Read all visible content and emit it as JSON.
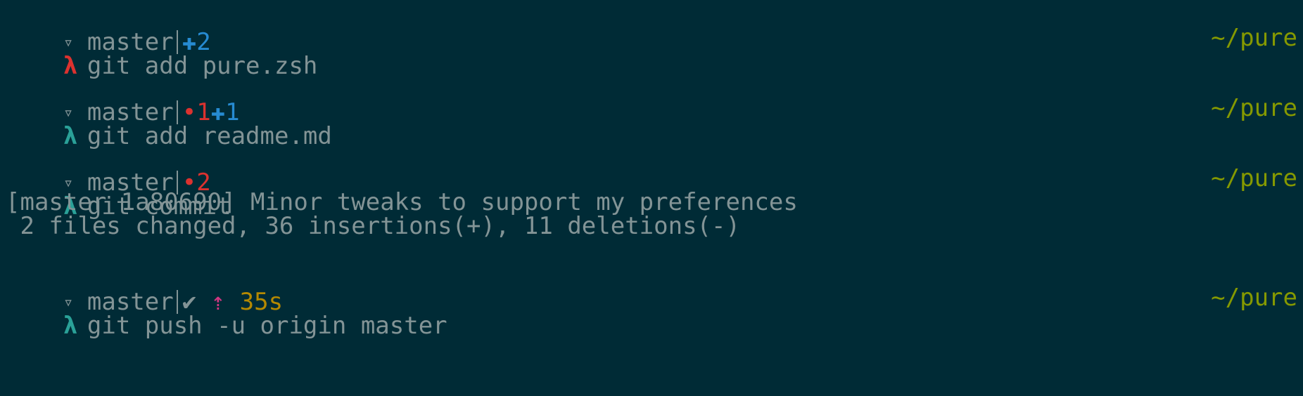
{
  "colors": {
    "background": "#002b36",
    "text": "#839496",
    "prompt_error": "#dc322f",
    "prompt_ok": "#2aa198",
    "staged": "#268bd2",
    "unstaged": "#dc322f",
    "clean": "#839496",
    "ahead": "#d33682",
    "exec_time": "#b58900",
    "path": "#859900"
  },
  "icons": {
    "branch": "▿",
    "prompt": "λ",
    "staged": "✚",
    "unstaged": "•",
    "clean": "✔",
    "ahead": "⇡"
  },
  "blocks": [
    {
      "status": {
        "branch": "master",
        "indicators": [
          {
            "kind": "staged",
            "text": "✚2",
            "color": "#268bd2"
          }
        ]
      },
      "prompt": {
        "symbol": "λ",
        "state": "error",
        "color": "#dc322f",
        "command": "git add pure.zsh",
        "path": "~/pure"
      },
      "output": []
    },
    {
      "status": {
        "branch": "master",
        "indicators": [
          {
            "kind": "unstaged",
            "text": "•1",
            "color": "#dc322f"
          },
          {
            "kind": "staged",
            "text": "✚1",
            "color": "#268bd2"
          }
        ]
      },
      "prompt": {
        "symbol": "λ",
        "state": "ok",
        "color": "#2aa198",
        "command": "git add readme.md",
        "path": "~/pure"
      },
      "output": []
    },
    {
      "status": {
        "branch": "master",
        "indicators": [
          {
            "kind": "unstaged",
            "text": "•2",
            "color": "#dc322f"
          }
        ]
      },
      "prompt": {
        "symbol": "λ",
        "state": "ok",
        "color": "#2aa198",
        "command": "git commit",
        "path": "~/pure"
      },
      "output": [
        "[master 1a80690] Minor tweaks to support my preferences",
        " 2 files changed, 36 insertions(+), 11 deletions(-)"
      ]
    },
    {
      "status": {
        "branch": "master",
        "indicators": [
          {
            "kind": "clean",
            "text": "✔ ",
            "color": "#839496"
          },
          {
            "kind": "ahead",
            "text": "⇡ ",
            "color": "#d33682"
          },
          {
            "kind": "exec-time",
            "text": "35s",
            "color": "#b58900"
          }
        ]
      },
      "prompt": {
        "symbol": "λ",
        "state": "ok",
        "color": "#2aa198",
        "command": "git push -u origin master",
        "path": "~/pure"
      },
      "output": []
    }
  ]
}
